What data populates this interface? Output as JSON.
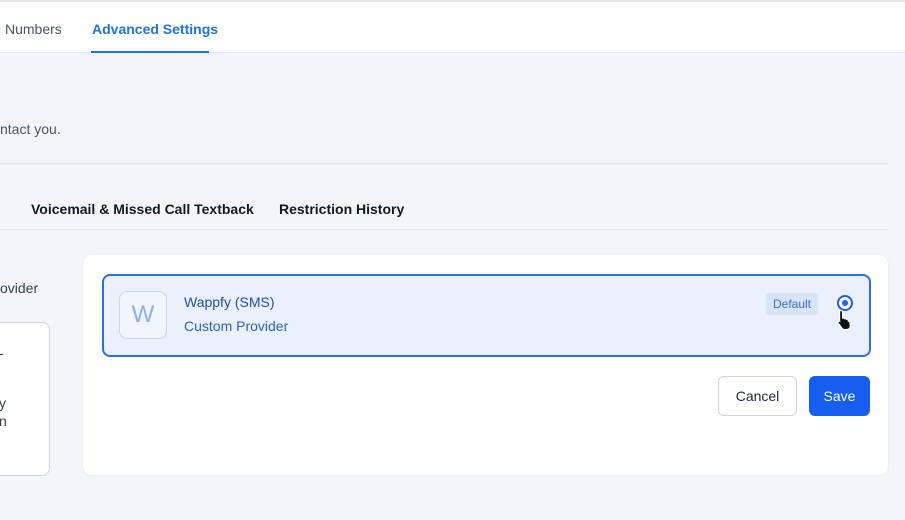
{
  "top_tabs": [
    {
      "label": "Numbers",
      "active": false
    },
    {
      "label": "Advanced Settings",
      "active": true
    }
  ],
  "description": "ntact you.",
  "sub_tabs": [
    {
      "label": "Voicemail & Missed Call Textback"
    },
    {
      "label": "Restriction History"
    }
  ],
  "left_panel": {
    "label": "ovider",
    "card_fragments": [
      "-",
      "y",
      "n"
    ]
  },
  "provider": {
    "avatar_letter": "W",
    "name": "Wappfy (SMS)",
    "type": "Custom Provider",
    "badge": "Default",
    "selected": true
  },
  "actions": {
    "cancel_label": "Cancel",
    "save_label": "Save"
  },
  "colors": {
    "accent": "#1f74e3",
    "primary_button": "#155eef",
    "selected_bg": "#eaf1fd",
    "selected_border": "#2f6fde"
  },
  "icons": [
    "radio-selected-icon",
    "pointer-cursor-icon"
  ]
}
